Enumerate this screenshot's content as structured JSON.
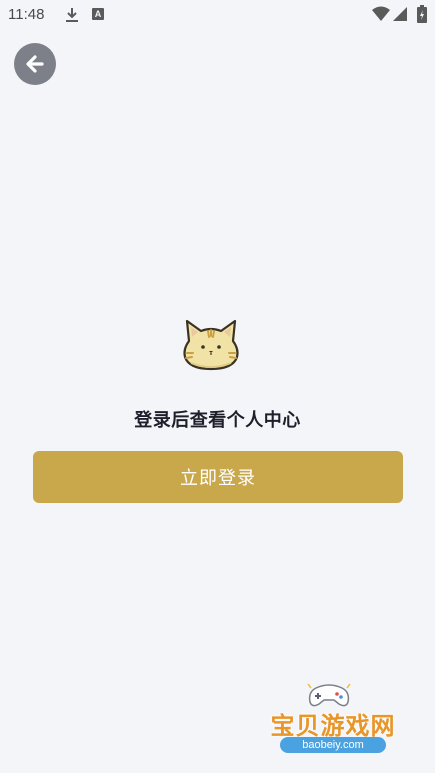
{
  "status_bar": {
    "time": "11:48",
    "icons": [
      "download-icon",
      "a-icon",
      "wifi-icon",
      "signal-icon",
      "battery-icon"
    ],
    "a_icon_letter": "A"
  },
  "header": {
    "back_icon": "arrow-left-icon"
  },
  "main": {
    "illustration": "cat-face-icon",
    "prompt": "登录后查看个人中心",
    "login_button_label": "立即登录"
  },
  "watermark": {
    "name": "宝贝游戏网",
    "domain": "baobeiy.com"
  },
  "colors": {
    "background": "#f4f5f9",
    "accent": "#c9a84c",
    "back_button": "#7d8089",
    "watermark_text": "#e8962a",
    "watermark_domain_bg": "#4aa3e0"
  }
}
